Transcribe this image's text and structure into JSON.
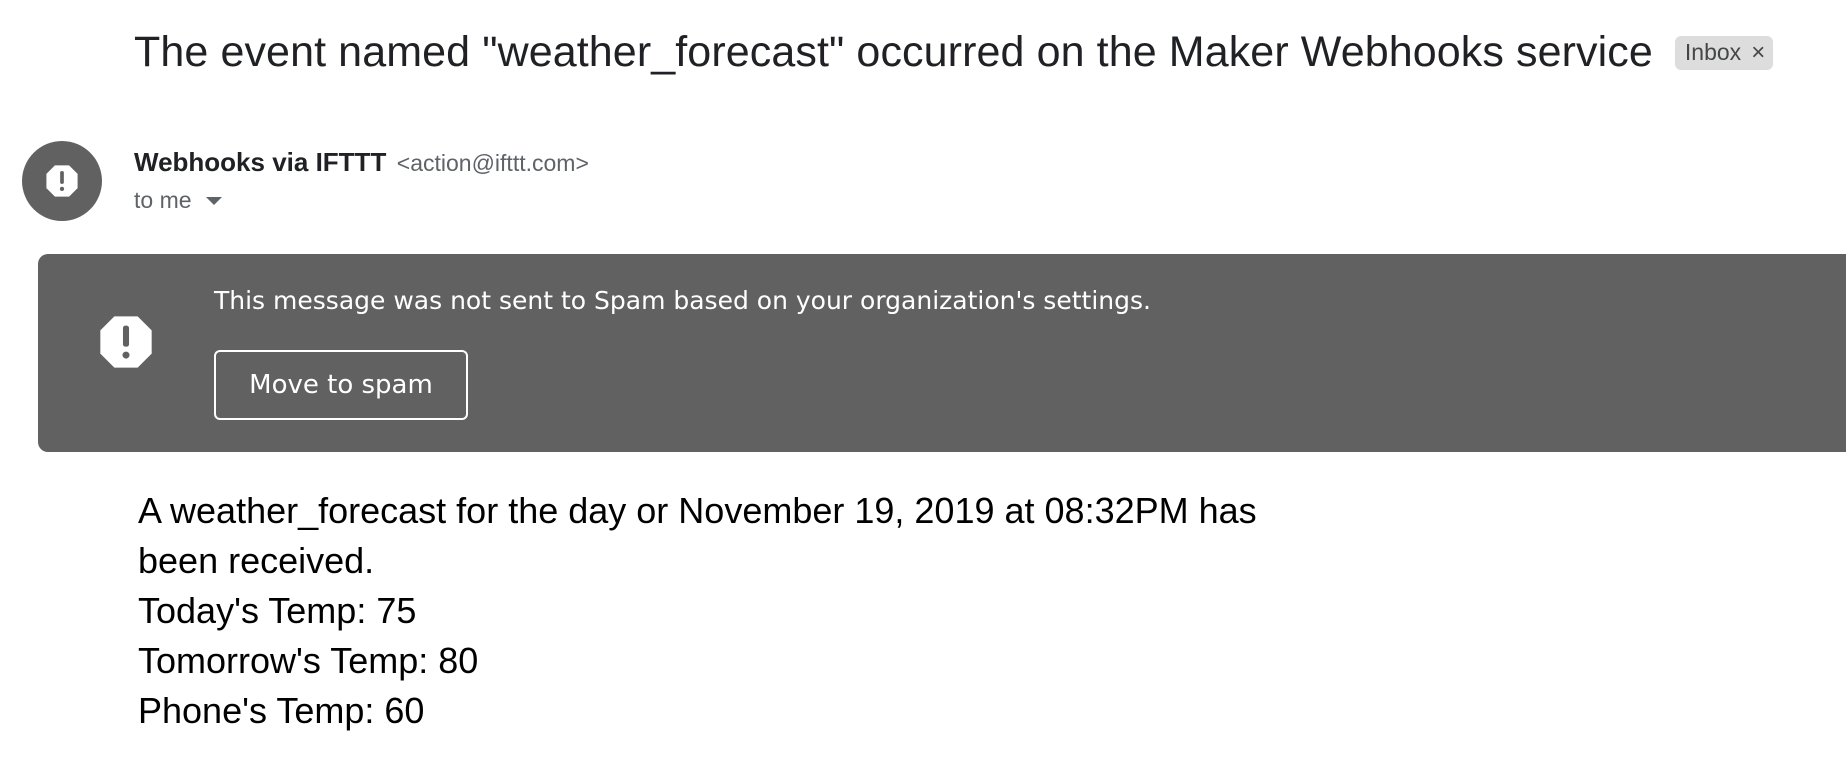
{
  "email": {
    "subject": "The event named \"weather_forecast\" occurred on the Maker Webhooks service",
    "label": "Inbox",
    "label_remove_glyph": "×",
    "sender_name": "Webhooks via IFTTT",
    "sender_email": "<action@ifttt.com>",
    "recipient_text": "to me",
    "avatar_icon": "alert-octagon-icon"
  },
  "spam_banner": {
    "message": "This message was not sent to Spam based on your organization's settings.",
    "button_label": "Move to spam",
    "icon": "alert-octagon-icon"
  },
  "body": {
    "lines": [
      "A weather_forecast for the day or November 19, 2019 at 08:32PM has been received.",
      "Today's Temp: 75",
      "Tomorrow's Temp: 80",
      "Phone's Temp: 60"
    ]
  },
  "colors": {
    "banner_bg": "#616161",
    "avatar_bg": "#616161",
    "chip_bg": "#dddddd"
  }
}
